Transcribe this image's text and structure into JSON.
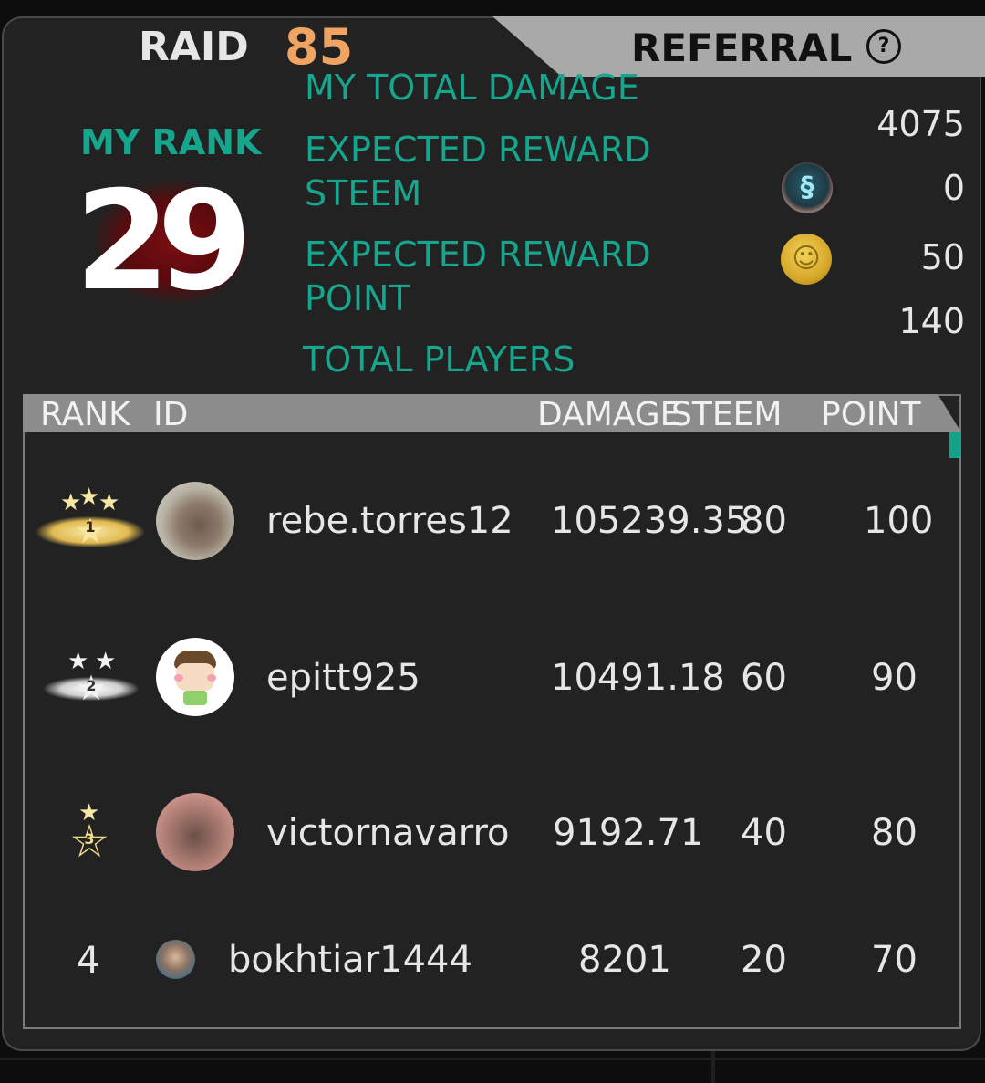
{
  "tabs": {
    "raid_label": "RAID",
    "raid_number": "85",
    "referral_label": "REFERRAL",
    "help_glyph": "?"
  },
  "summary": {
    "my_rank_label": "MY RANK",
    "my_rank_value": "29",
    "total_damage_label": "MY TOTAL DAMAGE",
    "total_damage_value": "4075",
    "reward_steem_label_1": "EXPECTED REWARD",
    "reward_steem_label_2": "STEEM",
    "reward_steem_value": "0",
    "reward_point_label_1": "EXPECTED REWARD",
    "reward_point_label_2": "POINT",
    "reward_point_value": "50",
    "total_players_label": "TOTAL PLAYERS",
    "total_players_value": "140",
    "steem_icon": "steem-coin-icon",
    "point_icon": "point-coin-icon"
  },
  "table": {
    "headers": {
      "rank": "RANK",
      "id": "ID",
      "damage": "DAMAGE",
      "steem": "STEEM",
      "point": "POINT"
    },
    "rows": [
      {
        "rank": "1",
        "id": "rebe.torres12",
        "damage": "105239.35",
        "steem": "80",
        "point": "100"
      },
      {
        "rank": "2",
        "id": "epitt925",
        "damage": "10491.18",
        "steem": "60",
        "point": "90"
      },
      {
        "rank": "3",
        "id": "victornavarro",
        "damage": "9192.71",
        "steem": "40",
        "point": "80"
      },
      {
        "rank": "4",
        "id": "bokhtiar1444",
        "damage": "8201",
        "steem": "20",
        "point": "70"
      }
    ]
  },
  "colors": {
    "accent_teal": "#16a58d",
    "raid_orange": "#f0a464",
    "panel_bg": "#222222"
  }
}
